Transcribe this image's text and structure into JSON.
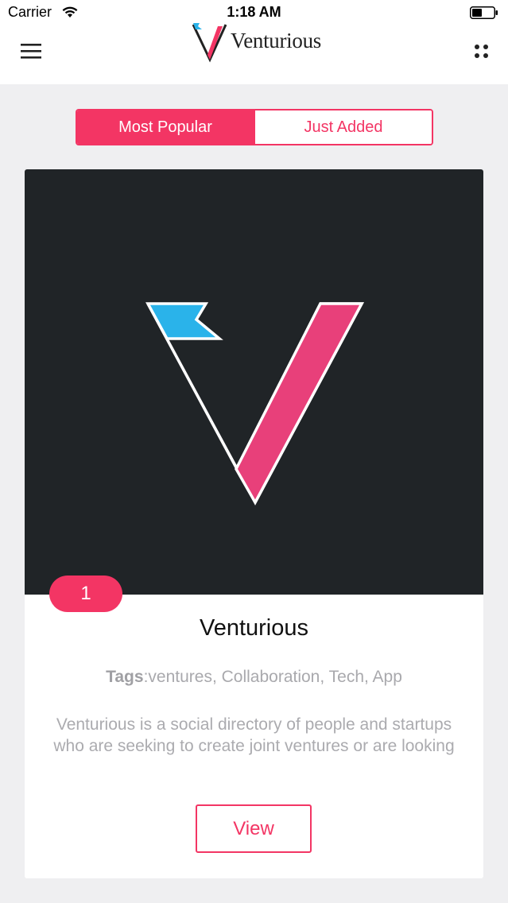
{
  "status_bar": {
    "carrier": "Carrier",
    "time": "1:18 AM"
  },
  "nav": {
    "menu_icon": "hamburger-menu-icon",
    "app_name": "Venturious",
    "more_icon": "four-dots-icon"
  },
  "tabs": [
    {
      "label": "Most Popular",
      "active": true
    },
    {
      "label": "Just Added",
      "active": false
    }
  ],
  "card": {
    "rank": "1",
    "title": "Venturious",
    "tags_label": "Tags",
    "tags_value": ":ventures, Collaboration, Tech, App",
    "description": "Venturious is a social directory of people and startups who are seeking to create joint ventures or are looking",
    "view_label": "View"
  },
  "colors": {
    "accent": "#f33564",
    "flag_blue": "#2ab3ea",
    "image_bg": "#202427",
    "page_bg": "#efeff1"
  }
}
